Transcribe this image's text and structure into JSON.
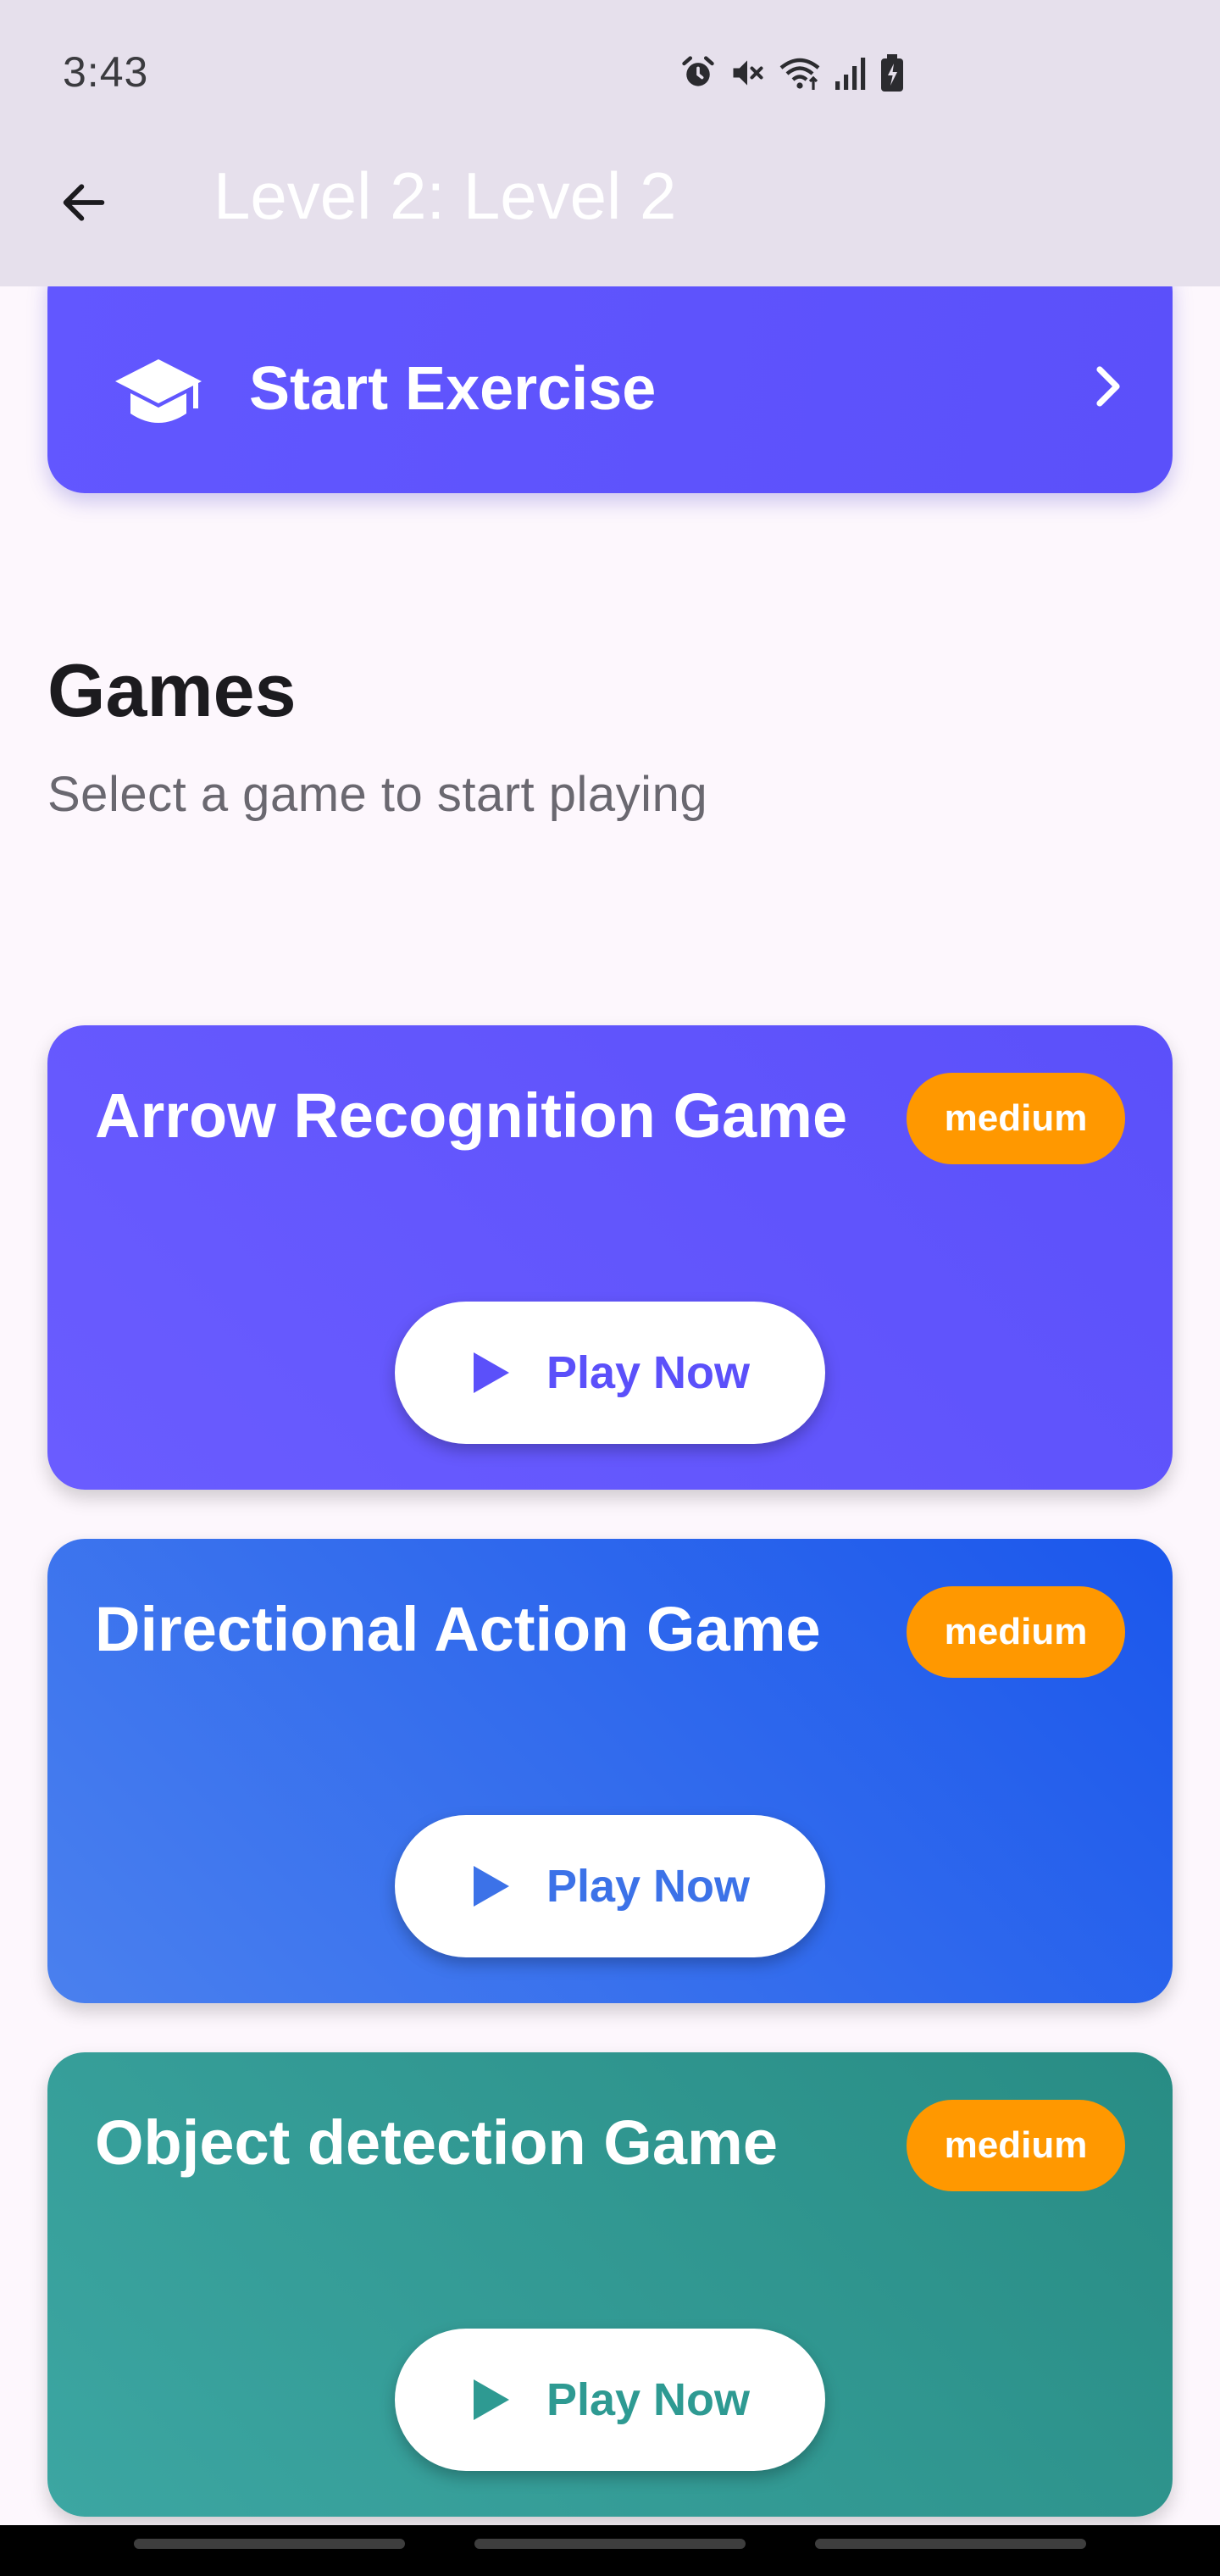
{
  "status_bar": {
    "time": "3:43",
    "icons": [
      "alarm-icon",
      "mute-icon",
      "wifi-icon",
      "signal-icon",
      "battery-icon"
    ]
  },
  "app_bar": {
    "title": "Level 2: Level 2",
    "back_icon": "arrow-left-icon"
  },
  "start_exercise": {
    "label": "Start Exercise",
    "icon": "graduation-cap-icon",
    "trailing_icon": "chevron-right-icon"
  },
  "games_section": {
    "title": "Games",
    "subtitle": "Select a game to start playing"
  },
  "games": [
    {
      "name": "Arrow Recognition Game",
      "difficulty": "medium",
      "button_label": "Play Now",
      "color": "#5B50FA"
    },
    {
      "name": "Directional Action Game",
      "difficulty": "medium",
      "button_label": "Play Now",
      "color": "#3C72E8"
    },
    {
      "name": "Object detection Game",
      "difficulty": "medium",
      "button_label": "Play Now",
      "color": "#2E9A92"
    }
  ],
  "colors": {
    "background": "#FDF7FD",
    "app_bar": "#E6E0EC",
    "accent": "#5B50FA",
    "badge": "#FF9800"
  }
}
